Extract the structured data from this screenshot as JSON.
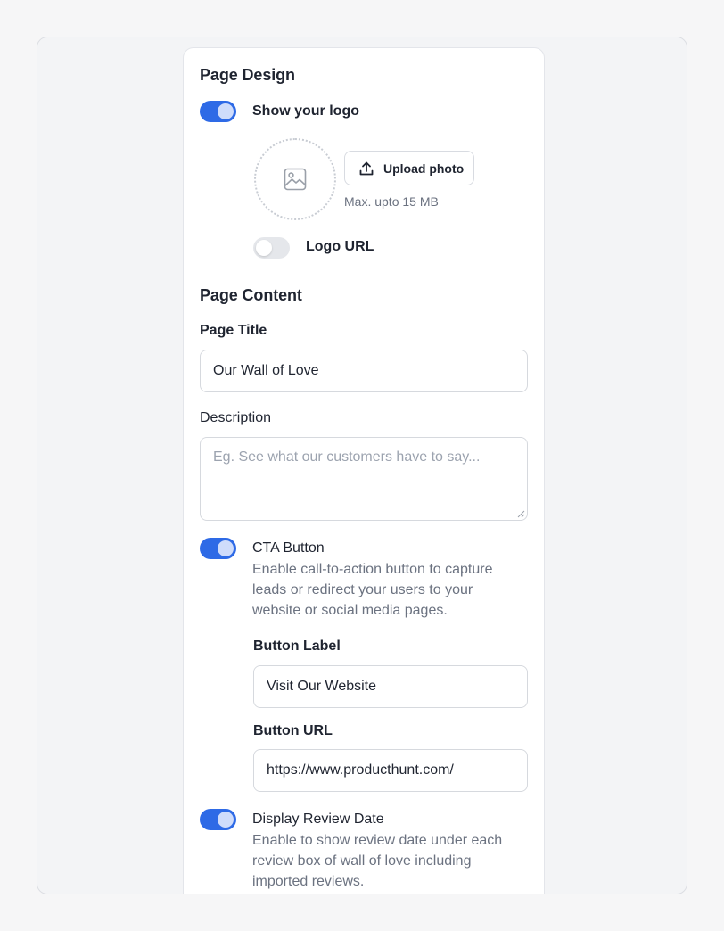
{
  "page_design": {
    "heading": "Page Design",
    "show_logo_label": "Show your logo",
    "show_logo_enabled": true,
    "upload_button_label": "Upload photo",
    "upload_hint": "Max. upto 15 MB",
    "logo_url_label": "Logo URL",
    "logo_url_enabled": false
  },
  "page_content": {
    "heading": "Page Content",
    "page_title_label": "Page Title",
    "page_title_value": "Our Wall of Love",
    "description_label": "Description",
    "description_placeholder": "Eg. See what our customers have to say..."
  },
  "cta": {
    "enabled": true,
    "title": "CTA Button",
    "description": "Enable call-to-action button to capture leads or redirect your users to your website or social media pages.",
    "button_label_label": "Button Label",
    "button_label_value": "Visit Our Website",
    "button_url_label": "Button URL",
    "button_url_value": "https://www.producthunt.com/"
  },
  "review_date": {
    "enabled": true,
    "title": "Display Review Date",
    "description": "Enable to show review date under each review box of wall of love including imported reviews."
  },
  "colors": {
    "accent": "#2e6ae6",
    "toggle_off": "#e5e7eb",
    "muted_text": "#6b7280"
  },
  "icons": {
    "upload": "upload-icon",
    "image_placeholder": "image-icon"
  }
}
